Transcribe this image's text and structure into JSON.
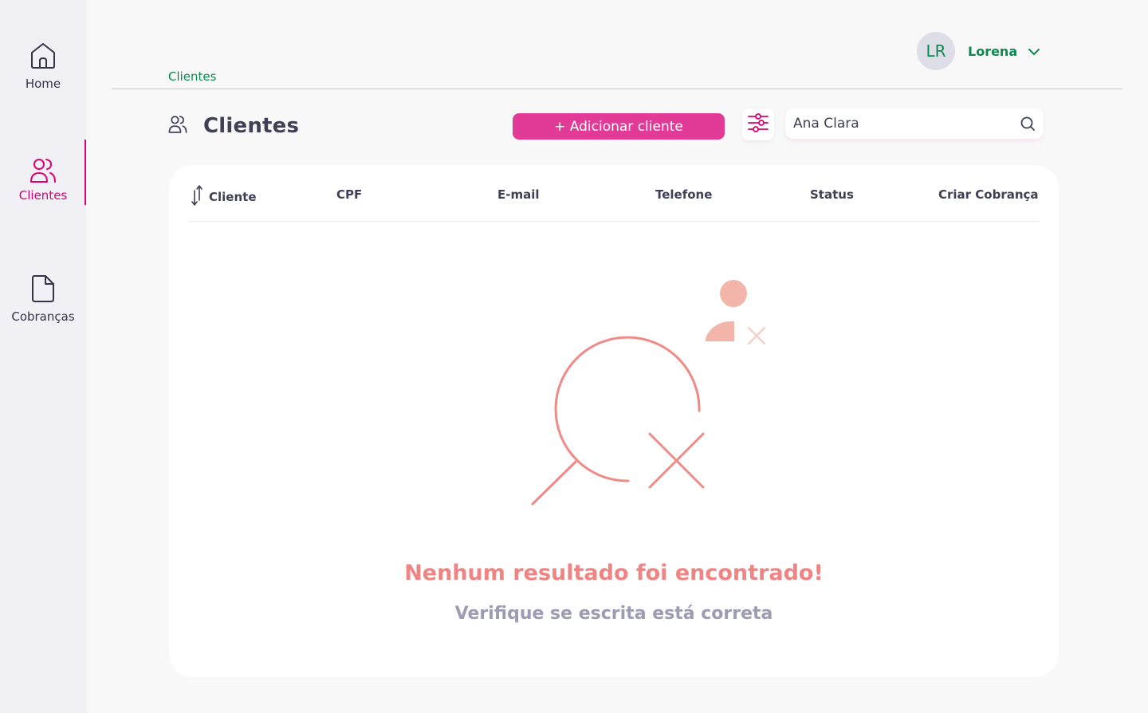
{
  "sidebar": {
    "items": [
      {
        "label": "Home",
        "icon": "home-icon",
        "active": false
      },
      {
        "label": "Clientes",
        "icon": "users-icon",
        "active": true
      },
      {
        "label": "Cobranças",
        "icon": "document-icon",
        "active": false
      }
    ]
  },
  "user": {
    "initials": "LR",
    "name": "Lorena"
  },
  "breadcrumb": "Clientes",
  "page": {
    "title": "Clientes",
    "add_button": "+ Adicionar cliente",
    "search_value": "Ana Clara"
  },
  "table": {
    "columns": [
      "Cliente",
      "CPF",
      "E-mail",
      "Telefone",
      "Status",
      "Criar Cobrança"
    ]
  },
  "empty_state": {
    "title": "Nenhum resultado foi encontrado!",
    "subtitle": "Verifique se escrita está correta"
  },
  "colors": {
    "accent": "#da0175",
    "green": "#0e8750",
    "empty_title": "#ef8583",
    "empty_sub": "#9c9cb2"
  }
}
